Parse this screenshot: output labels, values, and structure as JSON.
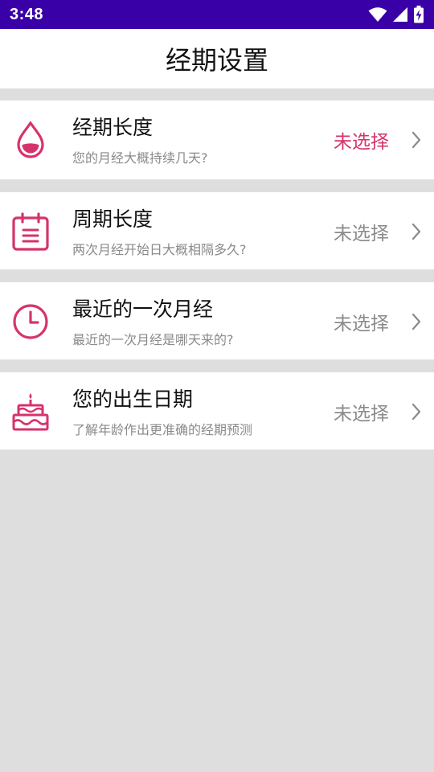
{
  "status_bar": {
    "time": "3:48"
  },
  "app_bar": {
    "title": "经期设置"
  },
  "colors": {
    "accent": "#d6336c",
    "status_bar": "#3a00a8",
    "muted": "#8a8a8a"
  },
  "settings": [
    {
      "title": "经期长度",
      "subtitle": "您的月经大概持续几天?",
      "value": "未选择",
      "icon": "blood-drop-icon",
      "value_highlighted": true
    },
    {
      "title": "周期长度",
      "subtitle": "两次月经开始日大概相隔多久?",
      "value": "未选择",
      "icon": "calendar-icon",
      "value_highlighted": false
    },
    {
      "title": "最近的一次月经",
      "subtitle": "最近的一次月经是哪天来的?",
      "value": "未选择",
      "icon": "clock-icon",
      "value_highlighted": false
    },
    {
      "title": "您的出生日期",
      "subtitle": "了解年龄作出更准确的经期预测",
      "value": "未选择",
      "icon": "birthday-cake-icon",
      "value_highlighted": false
    }
  ]
}
